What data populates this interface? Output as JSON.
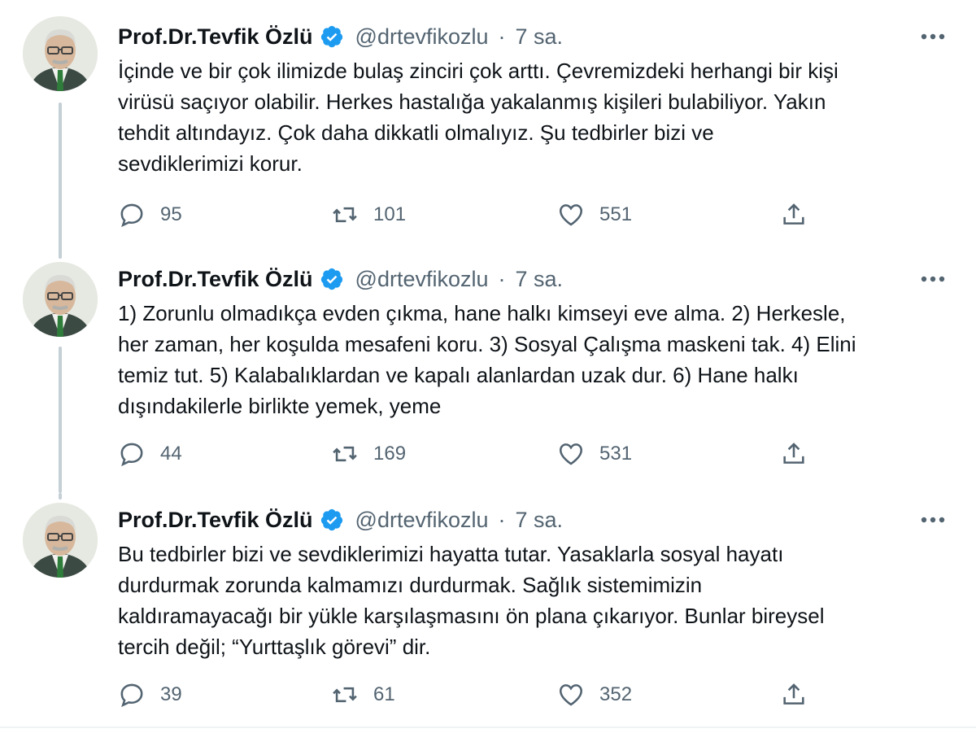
{
  "author": {
    "name": "Prof.Dr.Tevfik Özlü",
    "handle": "@drtevfikozlu",
    "time": "7 sa."
  },
  "separator": "·",
  "colors": {
    "verified": "#1d9bf0",
    "secondary_text": "#536471",
    "thread_line": "#c4cfd6"
  },
  "icons": {
    "reply": "reply-icon",
    "retweet": "retweet-icon",
    "like": "like-icon",
    "share": "share-icon",
    "more": "more-icon",
    "verified": "verified-badge-icon"
  },
  "tweets": [
    {
      "text": "İçinde ve bir çok ilimizde bulaş zinciri çok arttı. Çevremizdeki herhangi bir kişi\nvirüsü saçıyor olabilir. Herkes hastalığa yakalanmış kişileri bulabiliyor. Yakın\ntehdit altındayız. Çok daha dikkatli olmalıyız. Şu tedbirler bizi ve\nsevdiklerimizi korur.",
      "replies": "95",
      "retweets": "101",
      "likes": "551"
    },
    {
      "text": "1) Zorunlu olmadıkça evden çıkma, hane halkı kimseyi eve alma. 2) Herkesle,\nher zaman, her koşulda mesafeni koru. 3) Sosyal Çalışma maskeni tak. 4) Elini\ntemiz tut. 5) Kalabalıklardan ve kapalı alanlardan uzak dur. 6) Hane halkı\ndışındakilerle birlikte yemek, yeme",
      "replies": "44",
      "retweets": "169",
      "likes": "531"
    },
    {
      "text": "Bu tedbirler bizi ve sevdiklerimizi hayatta tutar. Yasaklarla sosyal hayatı\ndurdurmak zorunda kalmamızı durdurmak. Sağlık sistemimizin\nkaldıramayacağı bir yükle karşılaşmasını ön plana çıkarıyor. Bunlar bireysel\ntercih değil; “Yurttaşlık görevi” dir.",
      "replies": "39",
      "retweets": "61",
      "likes": "352"
    }
  ]
}
